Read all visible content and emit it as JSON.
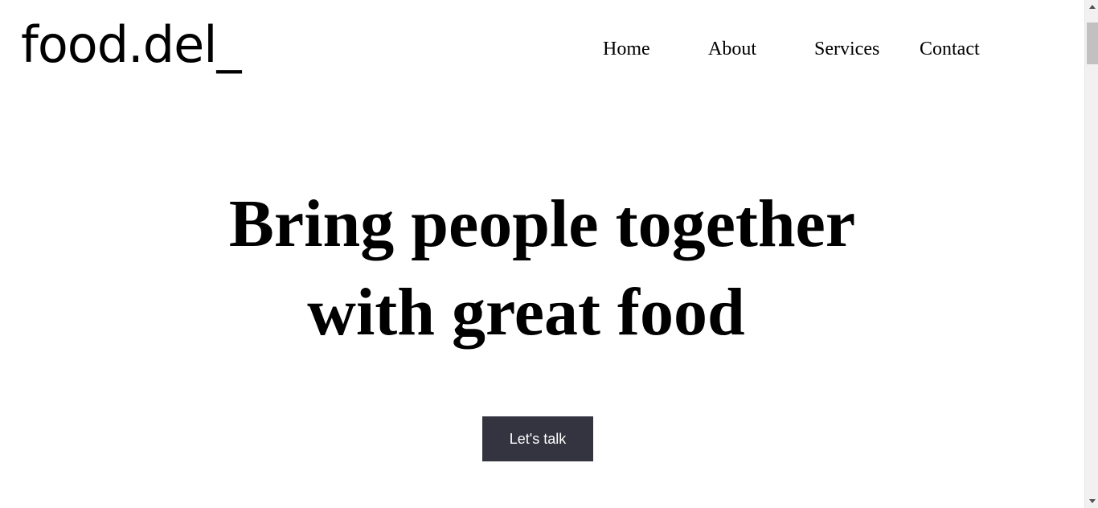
{
  "brand": {
    "logo_text": "food.del_"
  },
  "nav": {
    "items": [
      {
        "label": "Home"
      },
      {
        "label": "About"
      },
      {
        "label": "Services"
      },
      {
        "label": "Contact"
      }
    ]
  },
  "hero": {
    "title_line1": "Bring people together",
    "title_line2": "with great food",
    "cta_label": "Let's talk"
  },
  "colors": {
    "background": "#ffffff",
    "text": "#000000",
    "cta_background": "#343440",
    "cta_text": "#ffffff"
  },
  "scrollbar": {
    "up_icon": "chevron-up-icon",
    "down_icon": "chevron-down-icon"
  }
}
